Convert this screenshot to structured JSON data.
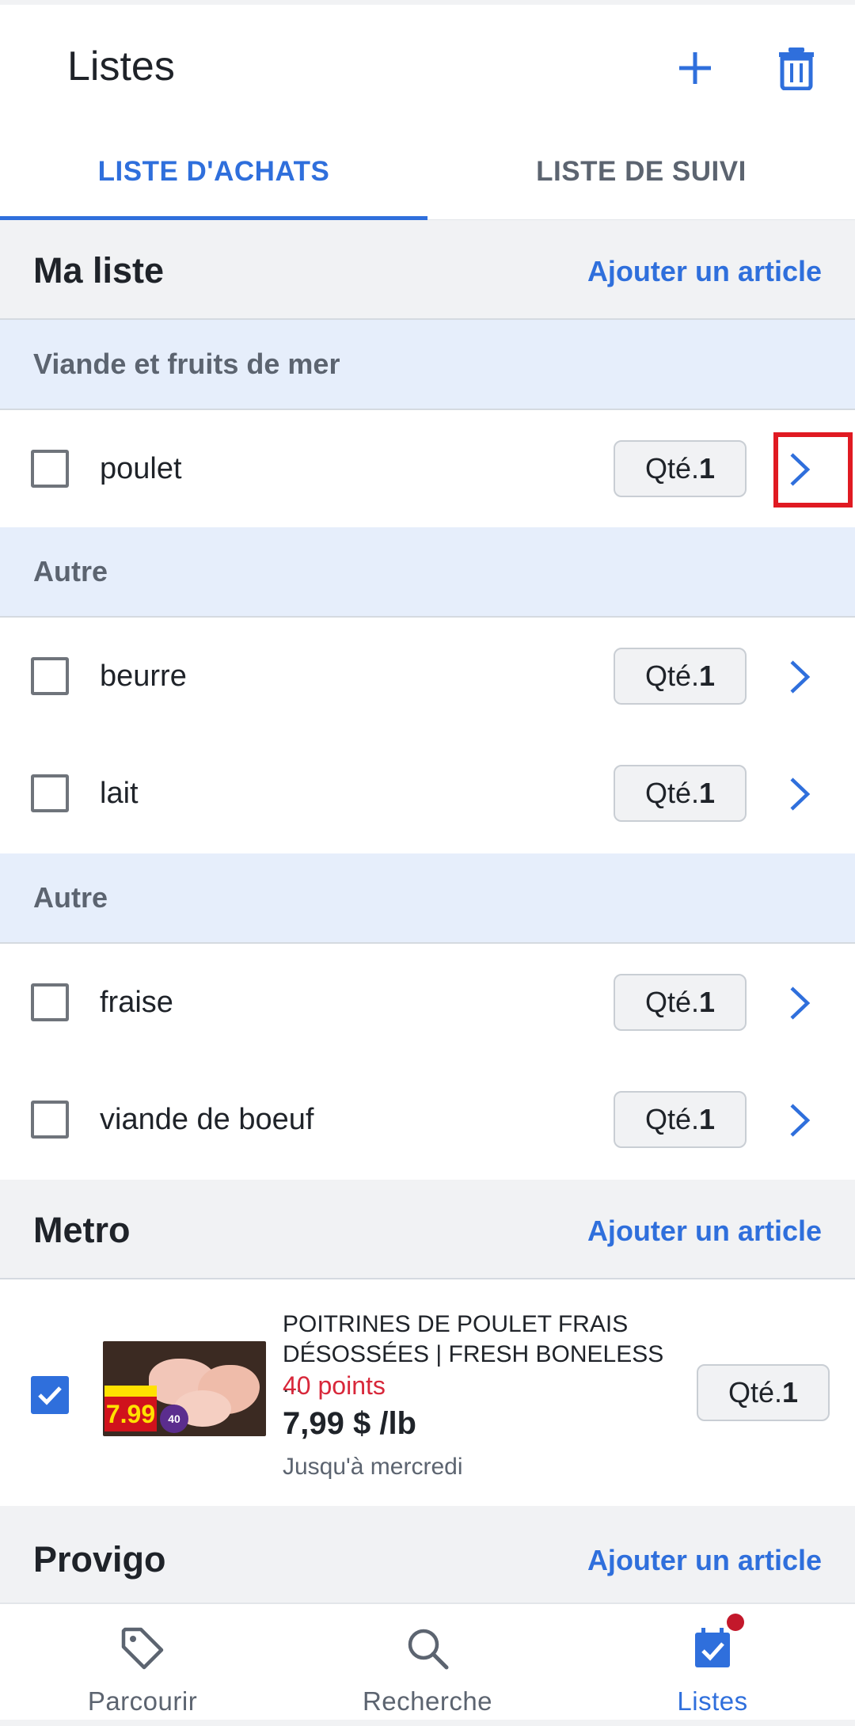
{
  "header": {
    "title": "Listes",
    "add_icon": "plus-icon",
    "delete_icon": "trash-icon"
  },
  "tabs": [
    {
      "label": "LISTE D'ACHATS",
      "active": true
    },
    {
      "label": "LISTE DE SUIVI",
      "active": false
    }
  ],
  "ma_liste": {
    "title": "Ma liste",
    "action": "Ajouter un article",
    "categories": [
      {
        "name": "Viande et fruits de mer",
        "items": [
          {
            "name": "poulet",
            "qty_label": "Qté.",
            "qty": "1",
            "checked": false
          }
        ]
      },
      {
        "name": "Autre",
        "items": [
          {
            "name": "beurre",
            "qty_label": "Qté.",
            "qty": "1",
            "checked": false
          },
          {
            "name": "lait",
            "qty_label": "Qté.",
            "qty": "1",
            "checked": false
          }
        ]
      },
      {
        "name": "Autre",
        "items": [
          {
            "name": "fraise",
            "qty_label": "Qté.",
            "qty": "1",
            "checked": false
          },
          {
            "name": "viande de boeuf",
            "qty_label": "Qté.",
            "qty": "1",
            "checked": false
          }
        ]
      }
    ]
  },
  "metro": {
    "title": "Metro",
    "action": "Ajouter un article",
    "product": {
      "name": "POITRINES DE POULET FRAIS DÉSOSSÉES | FRESH BONELESS ...",
      "points": "40 points",
      "price": "7,99 $ /lb",
      "validity": "Jusqu'à mercredi",
      "qty_label": "Qté.",
      "qty": "1",
      "checked": true,
      "image_price": "7.99",
      "image_points": "40"
    }
  },
  "provigo": {
    "title": "Provigo",
    "action": "Ajouter un article"
  },
  "bottom_nav": [
    {
      "label": "Parcourir",
      "icon": "tag-icon",
      "active": false
    },
    {
      "label": "Recherche",
      "icon": "search-icon",
      "active": false
    },
    {
      "label": "Listes",
      "icon": "calendar-check-icon",
      "active": true,
      "badge": true
    }
  ],
  "colors": {
    "accent": "#2f6fdc",
    "section_bg": "#f1f2f4",
    "category_bg": "#e6eefb",
    "points": "#d8273a",
    "highlight": "#e01a22",
    "badge": "#c3182b"
  }
}
